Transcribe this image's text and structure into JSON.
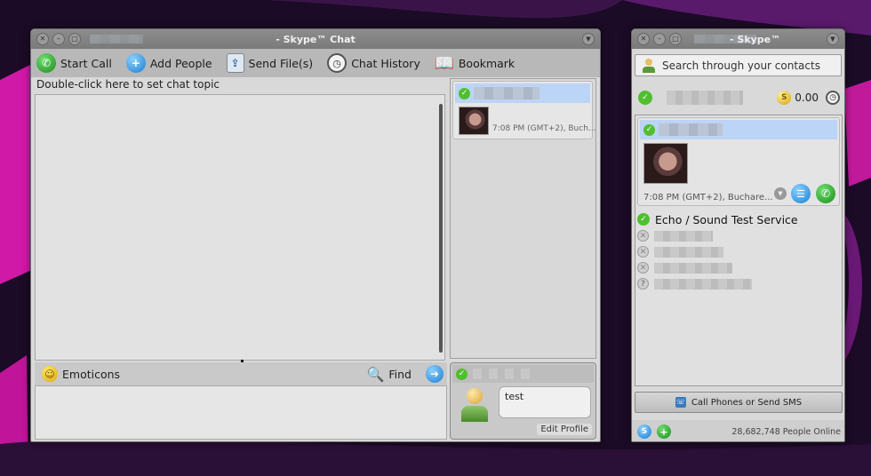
{
  "chat_window": {
    "title": "- Skype™ Chat",
    "toolbar": {
      "start_call": "Start Call",
      "add_people": "Add People",
      "send_files": "Send File(s)",
      "chat_history": "Chat History",
      "bookmark": "Bookmark"
    },
    "topic_placeholder": "Double-click here to set chat topic",
    "participant_time": "7:08 PM (GMT+2), Buch...",
    "emoticons_label": "Emoticons",
    "find_label": "Find",
    "mood_text": "test",
    "edit_profile_label": "Edit Profile"
  },
  "main_window": {
    "title": "- Skype™",
    "search_placeholder": "Search through your contacts",
    "credit": "0.00",
    "selected_contact_time": "7:08 PM (GMT+2), Buchare...",
    "contacts": [
      {
        "name": "Echo / Sound Test Service",
        "status": "online"
      }
    ],
    "call_phones_label": "Call Phones or Send SMS",
    "people_online": "28,682,748 People Online"
  },
  "colors": {
    "accent_blue": "#bcd4f5",
    "online_green": "#4fbf2f",
    "desktop_magenta": "#c81ea0"
  }
}
